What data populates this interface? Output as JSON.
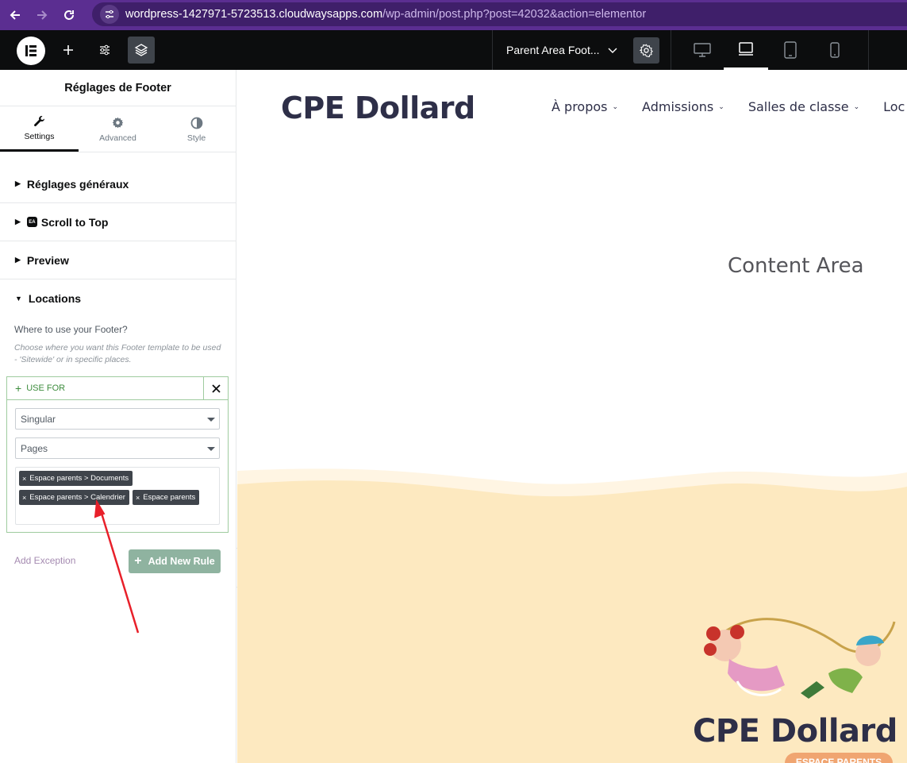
{
  "browser": {
    "url_host": "wordpress-1427971-5723513.cloudwaysapps.com",
    "url_path": "/wp-admin/post.php?post=42032&action=elementor"
  },
  "topbar": {
    "document_title": "Parent Area Foot...",
    "devices": [
      "desktop-icon",
      "tablet-landscape-icon",
      "tablet-portrait-icon",
      "mobile-icon"
    ],
    "active_device": "tablet-landscape-icon"
  },
  "panel": {
    "title": "Réglages de Footer",
    "tabs": [
      {
        "label": "Settings",
        "icon": "wrench-icon",
        "active": true
      },
      {
        "label": "Advanced",
        "icon": "gear-icon",
        "active": false
      },
      {
        "label": "Style",
        "icon": "contrast-icon",
        "active": false
      }
    ],
    "sections": {
      "general": "Réglages généraux",
      "scroll_top": "Scroll to Top",
      "preview": "Preview",
      "locations": "Locations"
    },
    "locations": {
      "label": "Where to use your Footer?",
      "description": "Choose where you want this Footer template to be used - 'Sitewide' or in specific places.",
      "rule": {
        "header": "USE FOR",
        "select_1": "Singular",
        "select_2": "Pages",
        "tags": [
          "Espace parents > Documents",
          "Espace parents > Calendrier",
          "Espace parents"
        ]
      },
      "add_exception": "Add Exception",
      "add_new_rule": "Add New Rule"
    }
  },
  "canvas": {
    "site_logo": "CPE Dollard",
    "menu": [
      "À propos",
      "Admissions",
      "Salles de classe",
      "Loc"
    ],
    "content_area": "Content Area",
    "footer_logo": "CPE Dollard",
    "footer_badge": "ESPACE PARENTS"
  },
  "colors": {
    "browser_purple": "#5b2e91",
    "elementor_dark": "#0c0d0e",
    "rule_green": "#3c8c3c",
    "footer_cream": "#fdeec8",
    "annotation_red": "#e8202a"
  }
}
